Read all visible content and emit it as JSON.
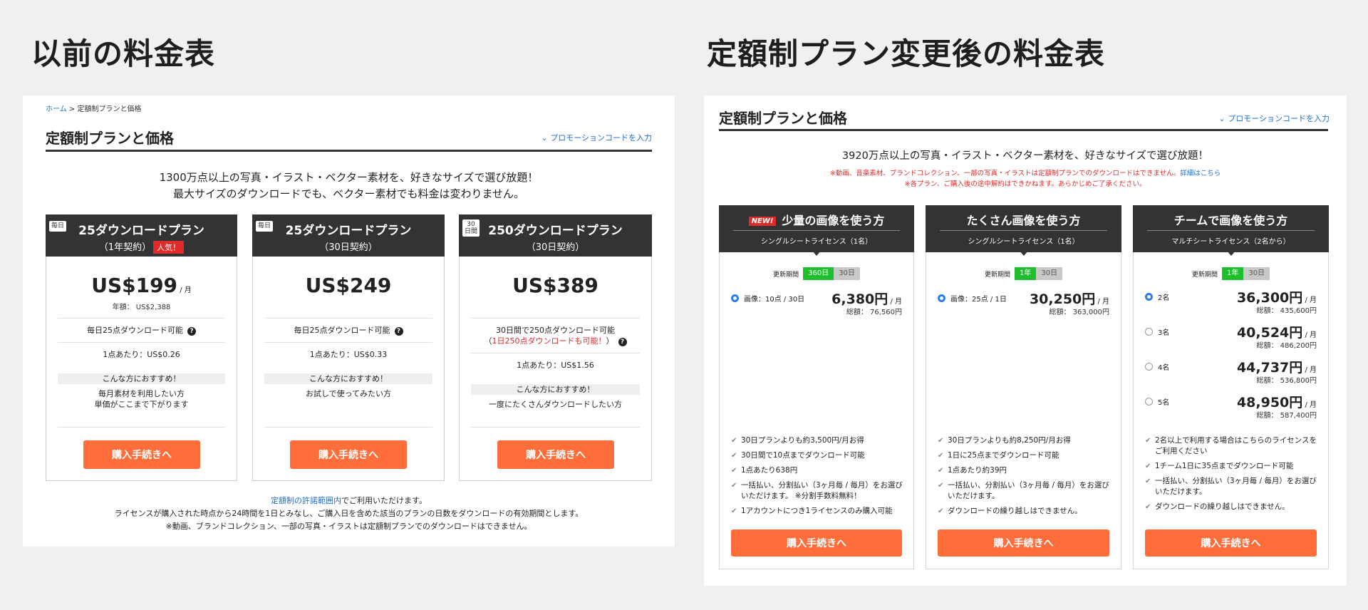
{
  "headings": {
    "left": "以前の料金表",
    "right": "定額制プラン変更後の料金表"
  },
  "left": {
    "breadcrumb_home": "ホーム",
    "breadcrumb_sep": " > ",
    "breadcrumb_current": "定額制プランと価格",
    "title": "定額制プランと価格",
    "promo": "プロモーションコードを入力",
    "intro_1": "1300万点以上の写真・イラスト・ベクター素材を、好きなサイズで選び放題！",
    "intro_2": "最大サイズのダウンロードでも、ベクター素材でも料金は変わりません。",
    "cards": [
      {
        "tag": "毎日",
        "name": "25ダウンロードプラン",
        "sub": "（1年契約）",
        "badge": "人気！",
        "price": "US$199",
        "per": " / 月",
        "yearly": "年額： US$2,388",
        "row1": "毎日25点ダウンロード可能",
        "row2": "1点あたり：US$0.26",
        "rec": "こんな方におすすめ！",
        "rec_1": "毎月素材を利用したい方",
        "rec_2": "単価がここまで下がります",
        "button": "購入手続きへ"
      },
      {
        "tag": "毎日",
        "name": "25ダウンロードプラン",
        "sub": "（30日契約）",
        "price": "US$249",
        "row1": "毎日25点ダウンロード可能",
        "row2": "1点あたり：US$0.33",
        "rec": "こんな方におすすめ！",
        "rec_1": "お試しで使ってみたい方",
        "button": "購入手続きへ"
      },
      {
        "tag_1": "30",
        "tag_2": "日間",
        "name": "250ダウンロードプラン",
        "sub": "（30日契約）",
        "price": "US$389",
        "row1a": "30日間で250点ダウンロード可能",
        "row1b_open": "（",
        "row1b_red": "1日250点ダウンロードも可能！",
        "row1b_close": "）",
        "row2": "1点あたり：US$1.56",
        "rec": "こんな方におすすめ！",
        "rec_1": "一度にたくさんダウンロードしたい方",
        "button": "購入手続きへ"
      }
    ],
    "foot_link": "定額制の許諾範囲内",
    "foot_1": "でご利用いただけます。",
    "foot_2": "ライセンスが購入された時点から24時間を1日とみなし、ご購入日を含めた該当のプランの日数をダウンロードの有効期間とします。",
    "foot_3": "※動画、ブランドコレクション、一部の写真・イラストは定額制プランでのダウンロードはできません。"
  },
  "right": {
    "title": "定額制プランと価格",
    "promo": "プロモーションコードを入力",
    "intro": "3920万点以上の写真・イラスト・ベクター素材を、好きなサイズで選び放題！",
    "note_1": "※動画、音楽素材、ブランドコレクション、一部の写真・イラストは定額制プランでのダウンロードはできません。",
    "note_1_link": "詳細はこちら",
    "note_2": "※各プラン、ご購入後の途中解約はできかねます。あらかじめご了承ください。",
    "cards": [
      {
        "new": "NEW!",
        "name": "少量の画像を使う方",
        "sub": "シングルシートライセンス（1名）",
        "term_label": "更新期間",
        "toggle_on": "360日",
        "toggle_off": "30日",
        "options": [
          {
            "label": "画像：10点 / 30日",
            "price": "6,380円",
            "per": " / 月",
            "total": "総額： 76,560円",
            "selected": true
          }
        ],
        "features": [
          "30日プランよりも約3,500円/月お得",
          "30日間で10点までダウンロード可能",
          "1点あたり638円",
          "一括払い、分割払い（3ヶ月毎 / 毎月）をお選びいただけます。 ※分割手数料無料！",
          "1アカウントにつき1ライセンスのみ購入可能"
        ],
        "button": "購入手続きへ"
      },
      {
        "name": "たくさん画像を使う方",
        "sub": "シングルシートライセンス（1名）",
        "term_label": "更新期間",
        "toggle_on": "1年",
        "toggle_off": "30日",
        "options": [
          {
            "label": "画像：25点 / 1日",
            "price": "30,250円",
            "per": " / 月",
            "total": "総額： 363,000円",
            "selected": true
          }
        ],
        "features": [
          "30日プランよりも約8,250円/月お得",
          "1日に25点までダウンロード可能",
          "1点あたり約39円",
          "一括払い、分割払い（3ヶ月毎 / 毎月）をお選びいただけます。",
          "ダウンロードの繰り越しはできません。"
        ],
        "button": "購入手続きへ"
      },
      {
        "name": "チームで画像を使う方",
        "sub": "マルチシートライセンス（2名から）",
        "term_label": "更新期間",
        "toggle_on": "1年",
        "toggle_off": "30日",
        "options": [
          {
            "label": "2名",
            "price": "36,300円",
            "per": " / 月",
            "total": "総額： 435,600円",
            "selected": true
          },
          {
            "label": "3名",
            "price": "40,524円",
            "per": " / 月",
            "total": "総額： 486,200円",
            "selected": false
          },
          {
            "label": "4名",
            "price": "44,737円",
            "per": " / 月",
            "total": "総額： 536,800円",
            "selected": false
          },
          {
            "label": "5名",
            "price": "48,950円",
            "per": " / 月",
            "total": "総額： 587,400円",
            "selected": false
          }
        ],
        "features": [
          "2名以上で利用する場合はこちらのライセンスをご利用ください",
          "1チーム1日に35点までダウンロード可能",
          "一括払い、分割払い（3ヶ月毎 / 毎月）をお選びいただけます。",
          "ダウンロードの繰り越しはできません。"
        ],
        "button": "購入手続きへ"
      }
    ]
  },
  "colors": {
    "accent": "#ff6d3b",
    "dark": "#333333",
    "link": "#1a6fd0",
    "alert": "#e02b2b",
    "toggle": "#1fbe2d"
  }
}
